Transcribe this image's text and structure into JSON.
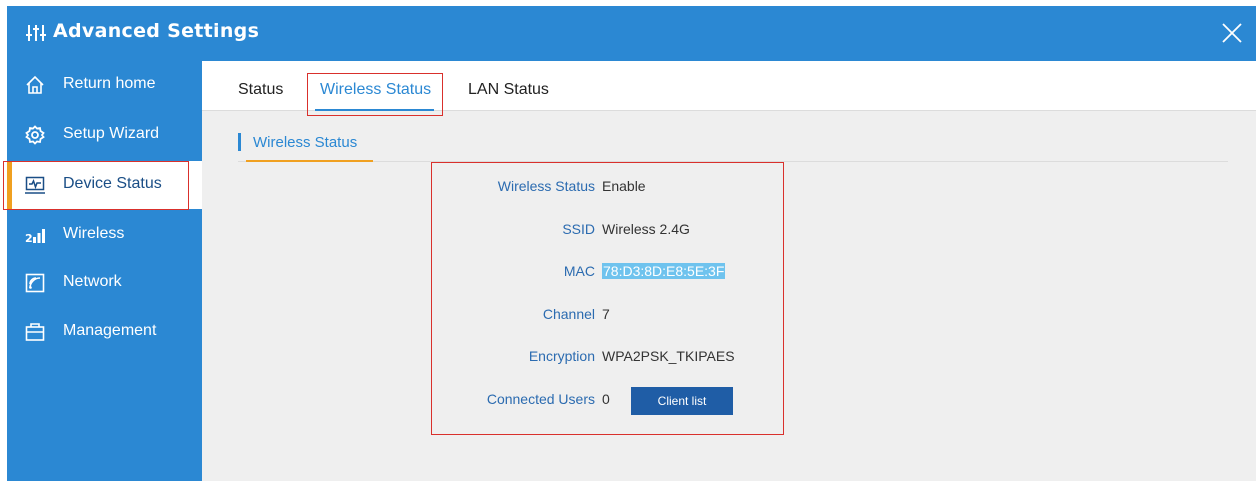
{
  "window": {
    "title": "Advanced Settings",
    "logo_icon": "sliders-icon",
    "close_icon": "close-icon"
  },
  "sidebar": {
    "items": [
      {
        "label": "Return home",
        "icon": "home-icon",
        "active": false
      },
      {
        "label": "Setup Wizard",
        "icon": "gear-icon",
        "active": false
      },
      {
        "label": "Device Status",
        "icon": "monitor-pulse-icon",
        "active": true
      },
      {
        "label": "Wireless",
        "icon": "signal-bars-icon",
        "active": false
      },
      {
        "label": "Network",
        "icon": "network-icon",
        "active": false
      },
      {
        "label": "Management",
        "icon": "toolbox-icon",
        "active": false
      }
    ]
  },
  "tabs": [
    {
      "label": "Status",
      "active": false
    },
    {
      "label": "Wireless Status",
      "active": true
    },
    {
      "label": "LAN Status",
      "active": false
    }
  ],
  "section": {
    "title": "Wireless Status"
  },
  "wireless_info": {
    "status": {
      "label": "Wireless Status",
      "value": "Enable"
    },
    "ssid": {
      "label": "SSID",
      "value": "Wireless 2.4G"
    },
    "mac": {
      "label": "MAC",
      "value": "78:D3:8D:E8:5E:3F"
    },
    "channel": {
      "label": "Channel",
      "value": "7"
    },
    "encryption": {
      "label": "Encryption",
      "value": "WPA2PSK_TKIPAES"
    },
    "users": {
      "label": "Connected Users",
      "value": "0"
    }
  },
  "buttons": {
    "client_list": "Client list"
  },
  "colors": {
    "primary": "#2b88d3",
    "accent": "#f0a020",
    "highlight_border": "#d9302c",
    "button": "#1f5da6"
  }
}
